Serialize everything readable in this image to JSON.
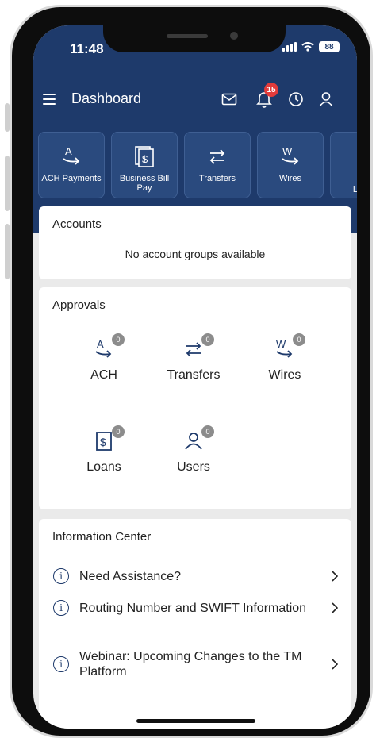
{
  "status_bar": {
    "time": "11:48",
    "battery": "88"
  },
  "app_bar": {
    "title": "Dashboard",
    "notification_count": "15",
    "icons": [
      "menu-icon",
      "mail-icon",
      "bell-icon",
      "clock-icon",
      "user-icon"
    ]
  },
  "quick_actions": [
    {
      "label": "ACH Payments",
      "icon": "ach-icon"
    },
    {
      "label": "Business Bill Pay",
      "icon": "bill-pay-icon"
    },
    {
      "label": "Transfers",
      "icon": "transfer-icon"
    },
    {
      "label": "Wires",
      "icon": "wire-icon"
    },
    {
      "label": "L",
      "icon": "loan-icon"
    }
  ],
  "accounts": {
    "title": "Accounts",
    "empty_message": "No account groups available"
  },
  "approvals": {
    "title": "Approvals",
    "items": [
      {
        "label": "ACH",
        "count": "0",
        "icon": "ach-icon"
      },
      {
        "label": "Transfers",
        "count": "0",
        "icon": "transfer-icon"
      },
      {
        "label": "Wires",
        "count": "0",
        "icon": "wire-icon"
      },
      {
        "label": "Loans",
        "count": "0",
        "icon": "loan-icon"
      },
      {
        "label": "Users",
        "count": "0",
        "icon": "user-icon"
      }
    ]
  },
  "info_center": {
    "title": "Information Center",
    "items": [
      {
        "text": "Need Assistance?"
      },
      {
        "text": "Routing Number and SWIFT Information"
      },
      {
        "text": "Webinar: Upcoming Changes to the TM Platform"
      }
    ]
  },
  "colors": {
    "primary": "#1e3a6b",
    "badge": "#e23b3b",
    "background": "#eaeaea"
  }
}
